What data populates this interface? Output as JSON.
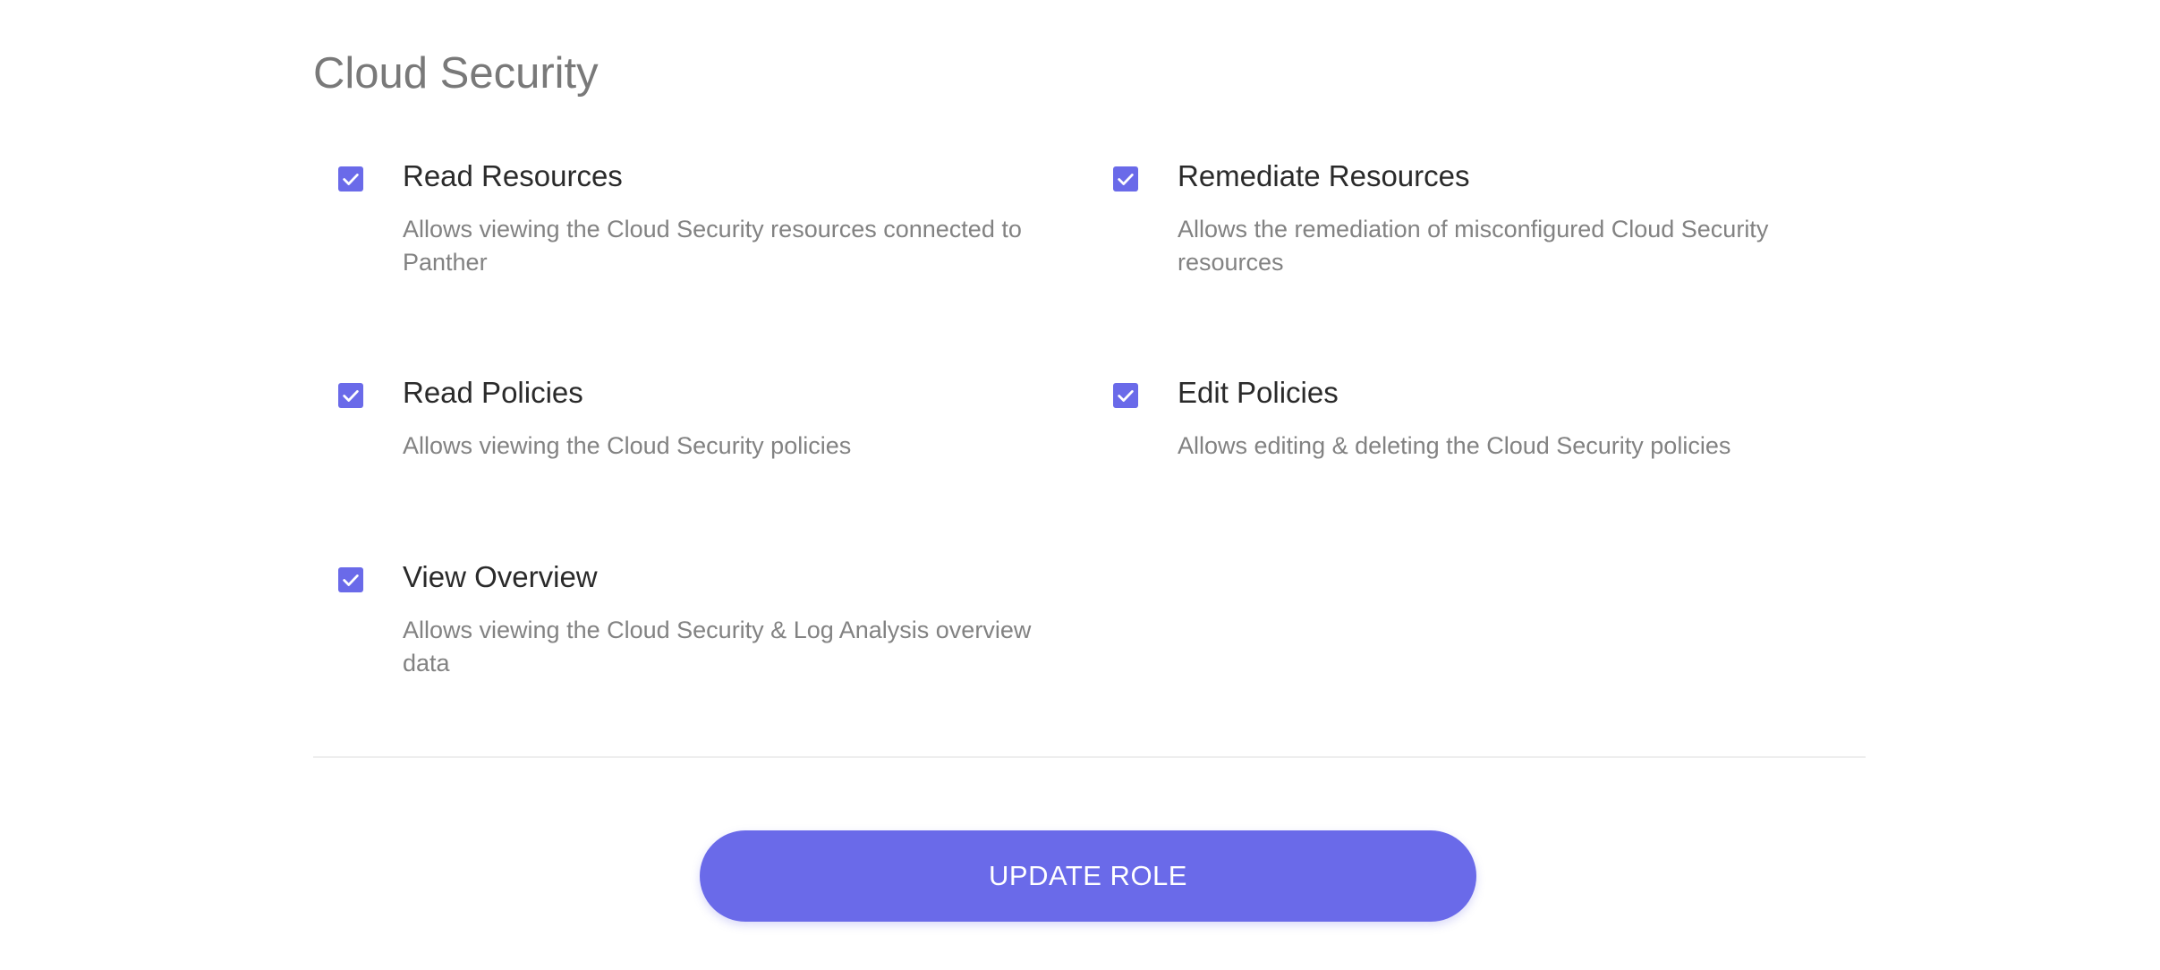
{
  "section": {
    "title": "Cloud Security"
  },
  "permissions": [
    {
      "title": "Read Resources",
      "description": "Allows viewing the Cloud Security resources connected to Panther",
      "checked": true
    },
    {
      "title": "Remediate Resources",
      "description": "Allows the remediation of misconfigured Cloud Security resources",
      "checked": true
    },
    {
      "title": "Read Policies",
      "description": "Allows viewing the Cloud Security policies",
      "checked": true
    },
    {
      "title": "Edit Policies",
      "description": "Allows editing & deleting the Cloud Security policies",
      "checked": true
    },
    {
      "title": "View Overview",
      "description": "Allows viewing the Cloud Security & Log Analysis overview data",
      "checked": true
    }
  ],
  "actions": {
    "update_label": "UPDATE ROLE"
  },
  "colors": {
    "accent": "#6a6ae9",
    "title_text": "#2a2a2a",
    "muted_text": "#828282",
    "divider": "#eeeeee"
  }
}
